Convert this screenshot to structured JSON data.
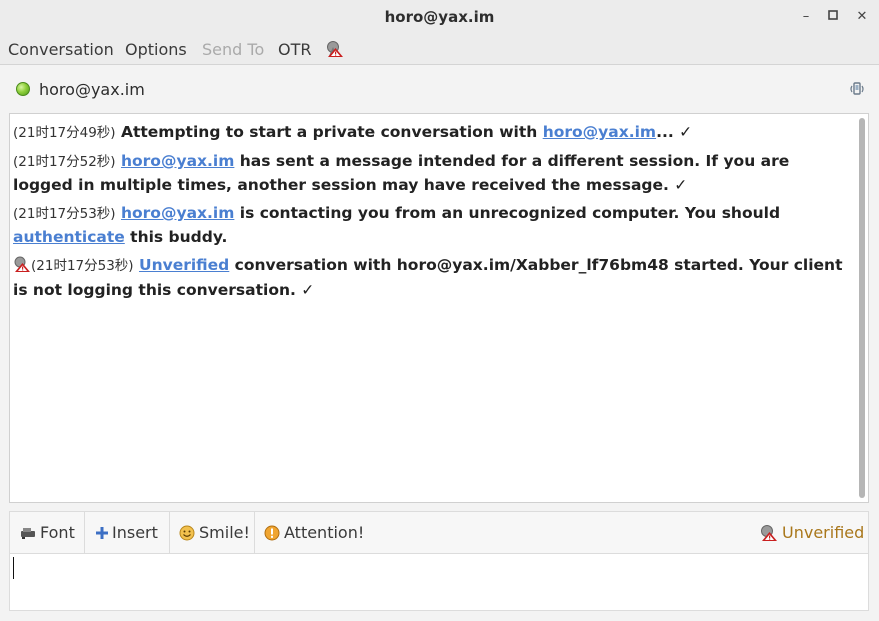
{
  "window": {
    "title": "horo@yax.im"
  },
  "menu": {
    "items": [
      {
        "label": "Conversation",
        "enabled": true
      },
      {
        "label": "Options",
        "enabled": true
      },
      {
        "label": "Send To",
        "enabled": false
      },
      {
        "label": "OTR",
        "enabled": true
      }
    ]
  },
  "buddy": {
    "name": "horo@yax.im",
    "status": "available"
  },
  "messages": [
    {
      "time": "(21时17分49秒)",
      "text_before": "Attempting to start a private conversation with ",
      "link": "horo@yax.im",
      "text_after": "... ✓"
    },
    {
      "time": "(21时17分52秒)",
      "link": "horo@yax.im",
      "text_after": " has sent a message intended for a different session. If you are logged in multiple times, another session may have received the message. ✓"
    },
    {
      "time": "(21时17分53秒)",
      "link": "horo@yax.im",
      "text_mid": " is contacting you from an unrecognized computer.  You should ",
      "link2": "authenticate",
      "text_after": " this buddy."
    },
    {
      "time": "(21时17分53秒)",
      "link": "Unverified",
      "text_after": " conversation with horo@yax.im/Xabber_lf76bm48 started.  Your client is not logging this conversation. ✓"
    }
  ],
  "toolbar": {
    "font": "Font",
    "insert": "Insert",
    "smile": "Smile!",
    "attention": "Attention!",
    "otr_status": "Unverified"
  },
  "colors": {
    "link": "#4a7fd1",
    "unverified": "#a9771b",
    "status_online": "#8fcf3c"
  }
}
